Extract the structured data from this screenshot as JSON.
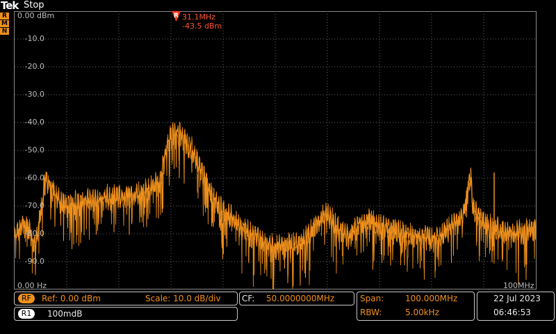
{
  "header": {
    "brand": "Tek",
    "acq_state": "Stop"
  },
  "indicators": [
    "R",
    "M",
    "N"
  ],
  "display": {
    "ref_level": "0.00 dBm",
    "y_ticks": [
      "-10.0",
      "-20.0",
      "-30.0",
      "-40.0",
      "-50.0",
      "-60.0",
      "-70.0",
      "-80.0",
      "-90.0"
    ],
    "x_start": "0.00 Hz",
    "x_end": "100MHz"
  },
  "marker": {
    "label": "R",
    "freq": "31.1MHz",
    "amp": "-43.5 dBm"
  },
  "rf_panel": {
    "badge": "RF",
    "ref": "Ref: 0.00 dBm",
    "scale": "Scale: 10.0 dB/div"
  },
  "r1_panel": {
    "badge": "R1",
    "value": "100mdB"
  },
  "cf_panel": {
    "label": "CF:",
    "value": "50.0000000MHz"
  },
  "span_panel": {
    "span_label": "Span:",
    "span_value": "100.000MHz",
    "rbw_label": "RBW:",
    "rbw_value": "5.00kHz"
  },
  "datetime": {
    "date": "22 Jul  2023",
    "time": "06:46:53"
  },
  "colors": {
    "trace": "#f0901c",
    "marker": "#ff3b1f",
    "grid": "#6a6a6a",
    "background": "#000000"
  },
  "chart_data": {
    "type": "line",
    "x_range_mhz": [
      0,
      100
    ],
    "y_range_dbm": [
      -100,
      0
    ],
    "series": [
      {
        "x": [
          0,
          2,
          4,
          6,
          8,
          10,
          12,
          15,
          18,
          20,
          22,
          25,
          28,
          29,
          30,
          31.1,
          32,
          34,
          36,
          38,
          40,
          42,
          45,
          48,
          50,
          52,
          55,
          58,
          60,
          62,
          64,
          66,
          68,
          70,
          72,
          74,
          76,
          78,
          80,
          82,
          84,
          86,
          87.5,
          88,
          90,
          92,
          94,
          96,
          98,
          100
        ],
        "y": [
          -82,
          -75,
          -85,
          -60,
          -67,
          -70,
          -69,
          -68,
          -67,
          -67,
          -66,
          -65,
          -61,
          -50,
          -45,
          -43.5,
          -45,
          -50,
          -58,
          -67,
          -72,
          -75,
          -80,
          -83,
          -85,
          -84,
          -84,
          -76,
          -73,
          -78,
          -81,
          -77,
          -75,
          -77,
          -78,
          -80,
          -80,
          -81,
          -82,
          -81,
          -77,
          -74,
          -59,
          -72,
          -76,
          -78,
          -79,
          -80,
          -79,
          -78
        ]
      }
    ]
  }
}
